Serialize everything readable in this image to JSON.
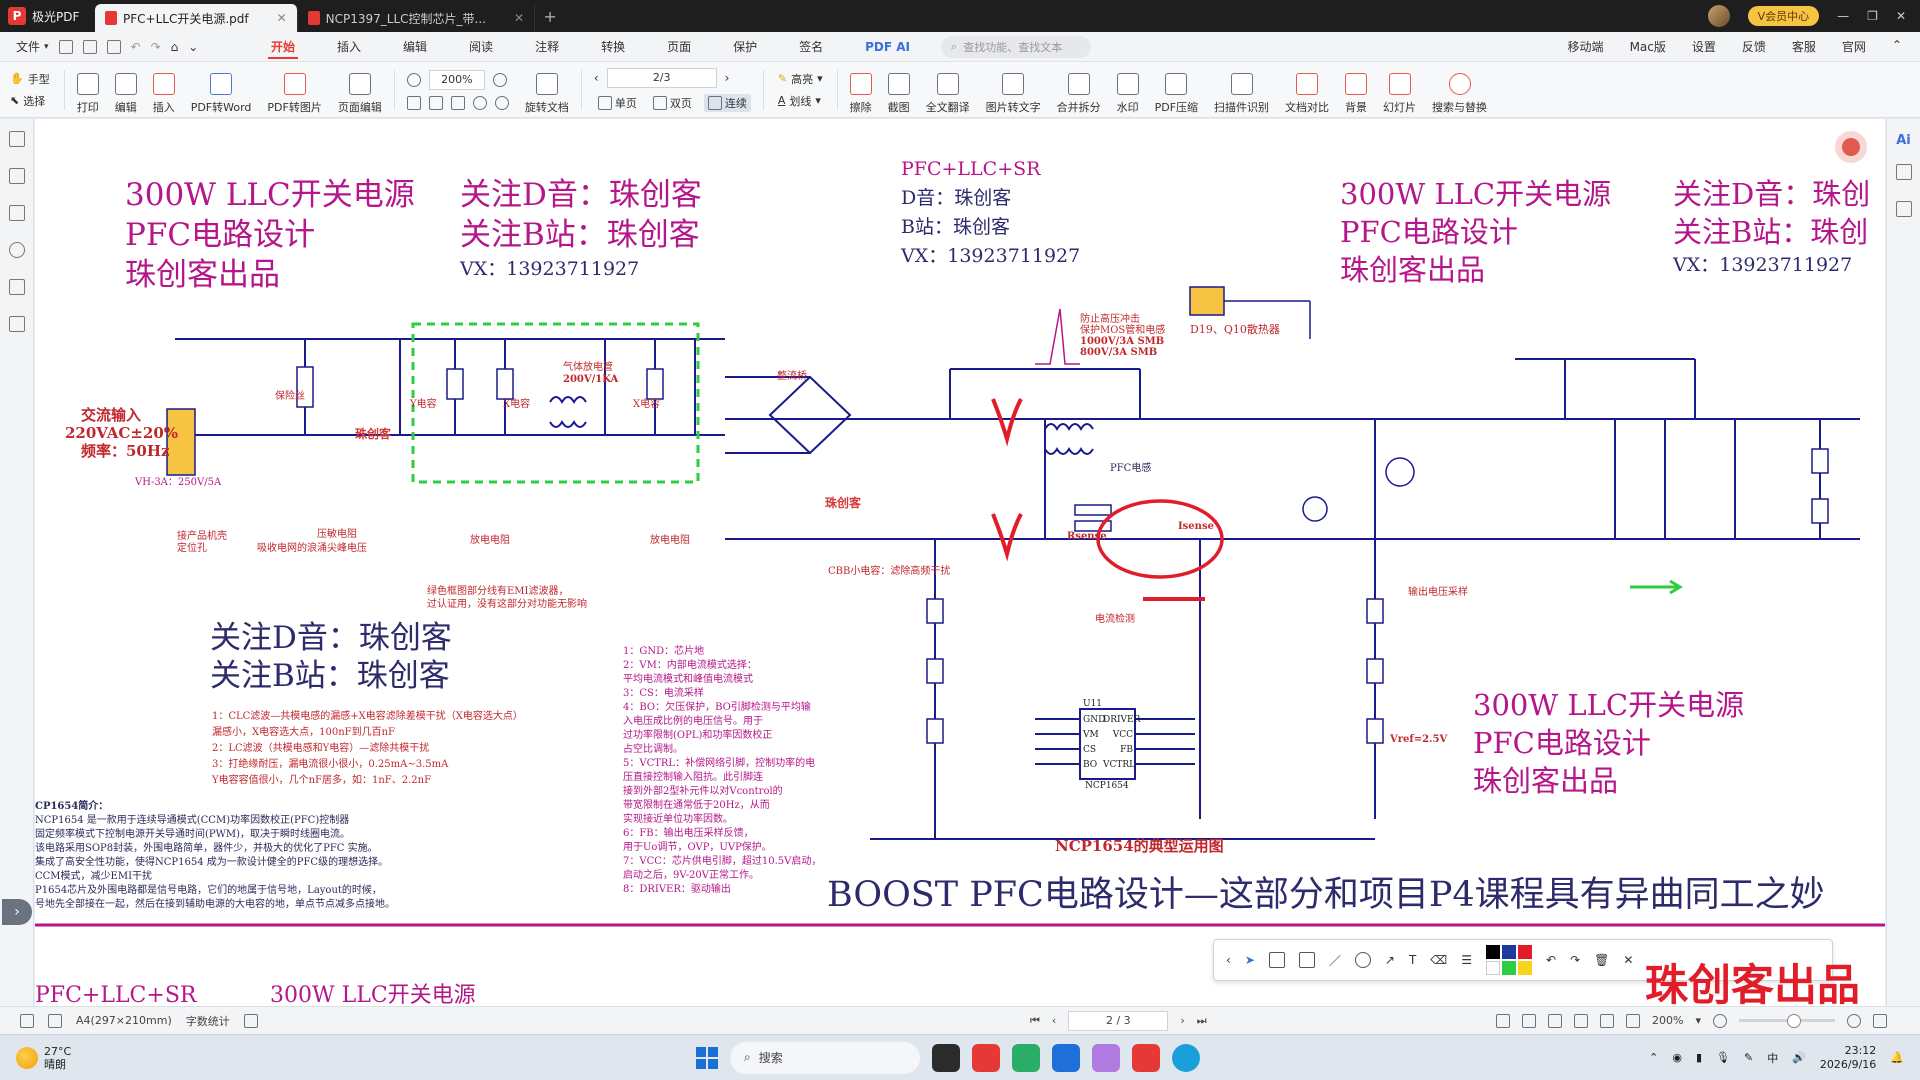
{
  "titlebar": {
    "app_name": "极光PDF",
    "tabs": [
      {
        "label": "PFC+LLC开关电源.pdf",
        "active": true
      },
      {
        "label": "NCP1397_LLC控制芯片_带...",
        "active": false
      }
    ],
    "vip_label": "V会员中心"
  },
  "menubar": {
    "file_label": "文件",
    "tabs": [
      "开始",
      "插入",
      "编辑",
      "阅读",
      "注释",
      "转换",
      "页面",
      "保护",
      "签名",
      "PDF AI"
    ],
    "active_tab": "开始",
    "search_placeholder": "查找功能、查找文本",
    "right_items": [
      "移动端",
      "Mac版",
      "设置",
      "反馈",
      "客服",
      "官网"
    ]
  },
  "ribbon": {
    "hand_label": "手型",
    "select_label": "选择",
    "buttons_left": [
      "打印",
      "编辑",
      "插入",
      "PDF转Word",
      "PDF转图片",
      "页面编辑"
    ],
    "zoom_value": "200%",
    "page_value": "2/3",
    "rotate_label": "旋转文档",
    "view_single": "单页",
    "view_double": "双页",
    "view_continuous": "连续",
    "highlight_label": "高亮",
    "underline_label": "划线",
    "buttons_right": [
      "擦除",
      "截图",
      "全文翻译",
      "图片转文字",
      "合并拆分",
      "水印",
      "PDF压缩",
      "扫描件识别",
      "文档对比",
      "背景",
      "幻灯片",
      "搜索与替换"
    ]
  },
  "document": {
    "title_block": {
      "line1": "300W LLC开关电源",
      "line2": "PFC电路设计",
      "line3": "珠创客出品"
    },
    "follow_block": {
      "line1": "关注D音：珠创客",
      "line2": "关注B站：珠创客",
      "vx": "VX：13923711927"
    },
    "center_block": {
      "line1": "PFC+LLC+SR",
      "line2": "D音：珠创客",
      "line3": "B站：珠创客",
      "vx": "VX：13923711927"
    },
    "right_block": {
      "line1": "300W LLC开关电源",
      "line2": "PFC电路设计",
      "line3": "珠创客出品"
    },
    "far_right_block": {
      "line1": "关注D音：珠创",
      "line2": "关注B站：珠创",
      "vx": "VX：13923711927"
    },
    "lower_follow": {
      "line1": "关注D音：珠创客",
      "line2": "关注B站：珠创客"
    },
    "lower_right_title": {
      "line1": "300W LLC开关电源",
      "line2": "PFC电路设计",
      "line3": "珠创客出品"
    },
    "ac_input": {
      "line1": "交流输入",
      "line2": "220VAC±20%",
      "line3": "频率：50Hz"
    },
    "vh3a": "VH-3A：250V/5A",
    "boost_title": "BOOST PFC电路设计—这部分和项目P4课程具有异曲同工之妙",
    "ncp_caption": "NCP1654的典型运用图",
    "brand_stamp": "珠创客出品",
    "bottom_cut_1": "PFC+LLC+SR",
    "bottom_cut_2": "300W LLC开关电源",
    "labels": {
      "zhuchuangke1": "珠创客",
      "zhuchuangke2": "珠创客",
      "y_cap": "Y电容",
      "x_cap1": "X电容",
      "x_cap2": "X电容",
      "rectifier": "整流桥",
      "pfc_inductor": "PFC电感",
      "current_detect": "电流检测",
      "heatsink": "D19、Q10散热器",
      "rsense": "Rsense",
      "isense": "Isense",
      "gas_tube": "气体放电管",
      "gas_tube_spec": "200V/1KA",
      "green_note_1": "绿色框图部分线有EMI滤波器，",
      "green_note_2": "过认证用，没有这部分对功能无影响",
      "vref": "Vref=2.5V",
      "discharge_r1": "放电电阻",
      "discharge_r2": "放电电阻",
      "varistor": "压敏电阻",
      "varistor_desc": "吸收电网的浪涌尖峰电压",
      "surge_1": "防止高压冲击",
      "surge_2": "保护MOS管和电感",
      "surge_3": "1000V/3A SMB",
      "surge_4": "800V/3A SMB",
      "cbb_note": "CBB小电容：滤除高频干扰",
      "ground_note": "接产品机壳",
      "ground_note2": "定位孔",
      "fuse_note": "保险丝",
      "output_div": "输出电压采样"
    },
    "notes_left": [
      "1：CLC滤波—共模电感的漏感+X电容滤除差模干扰（X电容选大点）",
      "   漏感小，X电容选大点，100nF到几百nF",
      "2：LC滤波（共模电感和Y电容）—滤除共模干扰",
      "3：打绝缘耐压，漏电流很小很小，0.25mA~3.5mA",
      "   Y电容容值很小，几个nF居多，如：1nF、2.2nF"
    ],
    "ncp_intro": [
      "CP1654简介：",
      "NCP1654 是一款用于连续导通模式(CCM)功率因数校正(PFC)控制器",
      "固定频率模式下控制电源开关导通时间(PWM)，取决于瞬时线圈电流。",
      "该电路采用SOP8封装，外围电路简单，器件少，并极大的优化了PFC 实施。",
      "集成了高安全性功能，使得NCP1654 成为一款设计健全的PFC级的理想选择。",
      "CCM模式，减少EMI干扰",
      "P1654芯片及外围电路都是信号电路，它们的地属于信号地，Layout的时候，",
      "号地先全部接在一起，然后在接到辅助电源的大电容的地，单点节点减多点接地。"
    ],
    "pin_notes": [
      "1：GND：芯片地",
      "2：VM：内部电流模式选择：",
      "   平均电流模式和峰值电流模式",
      "3：CS：电流采样",
      "4：BO：欠压保护，BO引脚检测与平均输",
      "   入电压成比例的电压信号。用于",
      "   过功率限制(OPL)和功率因数校正",
      "   占空比调制。",
      "5：VCTRL：补偿网络引脚，控制功率的电",
      "   压直接控制输入阻抗。此引脚连",
      "   接到外部2型补元件以对Vcontrol的",
      "   带宽限制在通常低于20Hz，从而",
      "   实现接近单位功率因数。",
      "6：FB：输出电压采样反馈，",
      "   用于Uo调节，OVP，UVP保护。",
      "7：VCC：芯片供电引脚，超过10.5V启动，",
      "   启动之后，9V-20V正常工作。",
      "8：DRIVER：驱动输出"
    ],
    "ic": {
      "name": "NCP1654",
      "ref": "U11",
      "pins_left": [
        "GND",
        "VM",
        "CS",
        "BO"
      ],
      "pins_right": [
        "DRIVER",
        "VCC",
        "FB",
        "VCTRL"
      ]
    }
  },
  "annotation_toolbar": {
    "colors": [
      "#000000",
      "#1e3a9e",
      "#e21d2a",
      "#ffffff",
      "#2ecc40",
      "#f7d31b"
    ]
  },
  "statusbar": {
    "paper": "A4(297×210mm)",
    "word_count": "字数统计",
    "page": "2 / 3",
    "zoom": "200%"
  },
  "taskbar": {
    "temp": "27°C",
    "weather": "晴朗",
    "search": "搜索",
    "time": "23:12",
    "date": "2026/9/16"
  }
}
